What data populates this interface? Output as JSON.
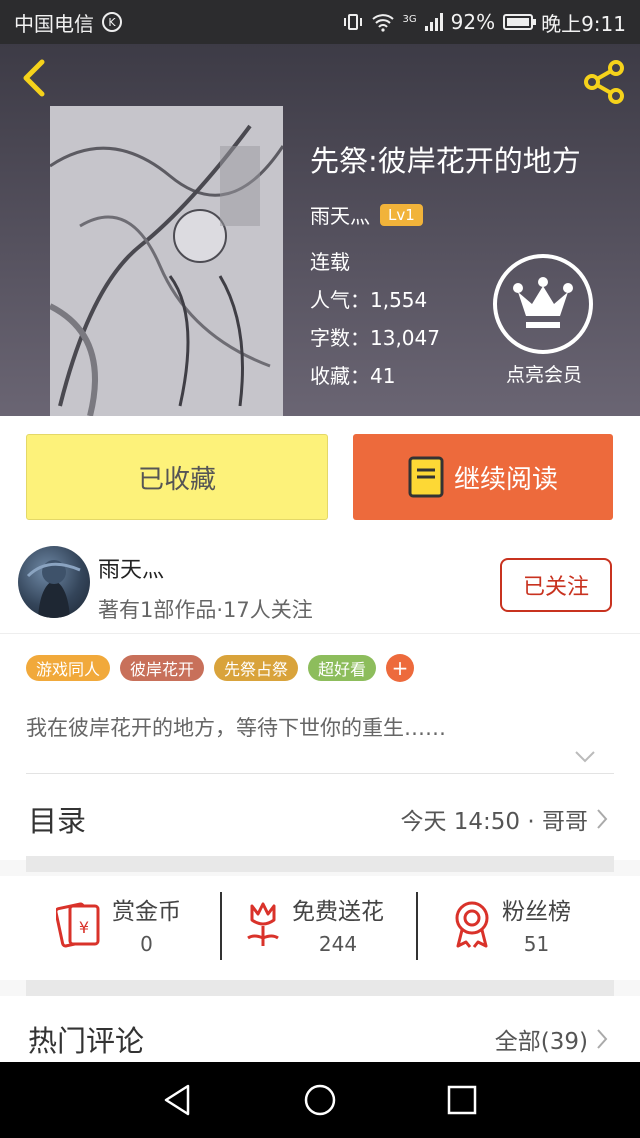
{
  "status_bar": {
    "carrier": "中国电信",
    "carrier_icon": "K",
    "network": "3G",
    "battery": "92%",
    "time": "晚上9:11"
  },
  "book": {
    "title": "先祭:彼岸花开的地方",
    "author": "雨天灬",
    "author_level": "Lv1",
    "status": "连载",
    "popularity_label": "人气：",
    "popularity": "1,554",
    "word_count_label": "字数：",
    "word_count": "13,047",
    "favorites_label": "收藏：",
    "favorites": "41",
    "vip_label": "点亮会员"
  },
  "actions": {
    "collected_label": "已收藏",
    "continue_label": "继续阅读"
  },
  "author_card": {
    "name": "雨天灬",
    "subtitle": "著有1部作品·17人关注",
    "follow_label": "已关注"
  },
  "tags": [
    {
      "label": "游戏同人",
      "color": "#f1a93b"
    },
    {
      "label": "彼岸花开",
      "color": "#c8705a"
    },
    {
      "label": "先祭占祭",
      "color": "#d9a33b"
    },
    {
      "label": "超好看",
      "color": "#8dbd5c"
    }
  ],
  "tag_add": "+",
  "synopsis": "我在彼岸花开的地方，等待下世你的重生……",
  "catalog": {
    "title": "目录",
    "update": "今天 14:50 · 哥哥"
  },
  "stats": [
    {
      "label": "赏金币",
      "value": "0",
      "icon": "red-envelope-icon"
    },
    {
      "label": "免费送花",
      "value": "244",
      "icon": "flower-icon"
    },
    {
      "label": "粉丝榜",
      "value": "51",
      "icon": "medal-icon"
    }
  ],
  "comments": {
    "title": "热门评论",
    "all": "全部(39)"
  },
  "colors": {
    "accent_orange": "#ed6a3c",
    "collected_yellow": "#fdf27a",
    "follow_red": "#c8321f",
    "level_badge": "#f1b33a"
  }
}
